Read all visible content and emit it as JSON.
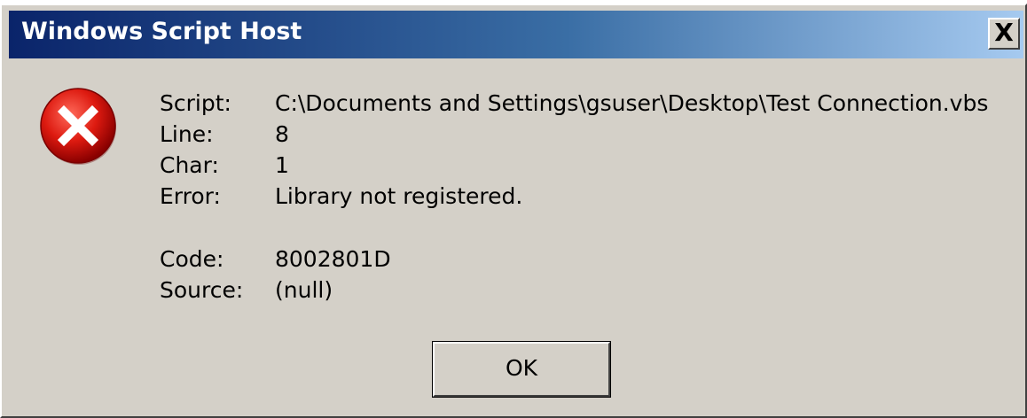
{
  "window": {
    "title": "Windows Script Host",
    "close_label": "X"
  },
  "icon": {
    "name": "error-icon",
    "color": "#cc0000"
  },
  "details": {
    "script_label": "Script:",
    "script_value": "C:\\Documents and Settings\\gsuser\\Desktop\\Test Connection.vbs",
    "line_label": "Line:",
    "line_value": "8",
    "char_label": "Char:",
    "char_value": "1",
    "error_label": "Error:",
    "error_value": "Library not registered.",
    "code_label": "Code:",
    "code_value": "8002801D",
    "source_label": "Source:",
    "source_value": "(null)"
  },
  "buttons": {
    "ok_label": "OK"
  },
  "colors": {
    "dialog_bg": "#d4d0c8",
    "title_start": "#0a246a",
    "title_end": "#a6caf0",
    "title_text": "#ffffff"
  }
}
